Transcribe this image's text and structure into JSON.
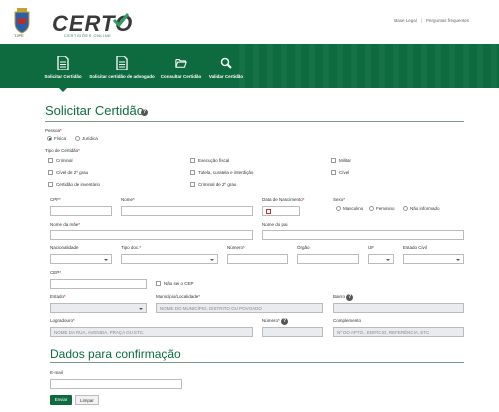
{
  "header": {
    "crest_caption": "TJPE",
    "logo_word": "CERTO",
    "logo_sub": "CERTIDÕES ONLINE",
    "links": [
      "Base Legal",
      "Perguntas frequentes"
    ]
  },
  "nav": [
    {
      "label": "Solicitar Certidão",
      "icon": "document-icon",
      "active": true
    },
    {
      "label": "Solicitar certidão de advogado",
      "icon": "document-icon",
      "active": false
    },
    {
      "label": "Consultar Certidão",
      "icon": "folder-open-icon",
      "active": false
    },
    {
      "label": "Validar Certidão",
      "icon": "search-icon",
      "active": false
    }
  ],
  "form": {
    "title": "Solicitar Certidão",
    "pessoa_label": "Pessoa",
    "pessoa_options": [
      "Física",
      "Jurídica"
    ],
    "tipo_label": "Tipo de Certidão",
    "tipos": [
      "Criminal",
      "Execução fiscal",
      "Militar",
      "Cível de 2º grau",
      "Tutela, curatela e interdição",
      "Cível",
      "Certidão de inventário",
      "Criminal de 2º grau"
    ],
    "cpf": "CPF",
    "nome": "Nome",
    "nasc": "Data de Nascimento",
    "sexo": "Sexo",
    "sexo_options": [
      "Masculino",
      "Feminino",
      "Não informado"
    ],
    "mae": "Nome da mãe",
    "pai": "Nome do pai",
    "nacionalidade": "Nacionalidade",
    "tipo_doc": "Tipo doc.",
    "numero_doc": "Número",
    "orgao": "Órgão",
    "uf": "UF",
    "estado_civil": "Estado Civil",
    "cep": "CEP",
    "sem_cep": "Não sei o CEP",
    "estado": "Estado",
    "municipio": "Município/Localidade",
    "municipio_ph": "NOME DO MUNICÍPIO, DISTRITO OU POVOADO",
    "bairro": "Bairro",
    "logradouro": "Logradouro",
    "logradouro_ph": "NOME DA RUA, AVENIDA, PRAÇA OU ETC.",
    "numero": "Número",
    "complemento": "Complemento",
    "complemento_ph": "Nº DO APTO., EDIFÍCIO, REFERÊNCIA, ETC"
  },
  "confirm": {
    "title": "Dados para confirmação",
    "email": "E-mail",
    "send": "Enviar",
    "clear": "Limpar"
  },
  "colors": {
    "brand": "#0e6b3f"
  }
}
